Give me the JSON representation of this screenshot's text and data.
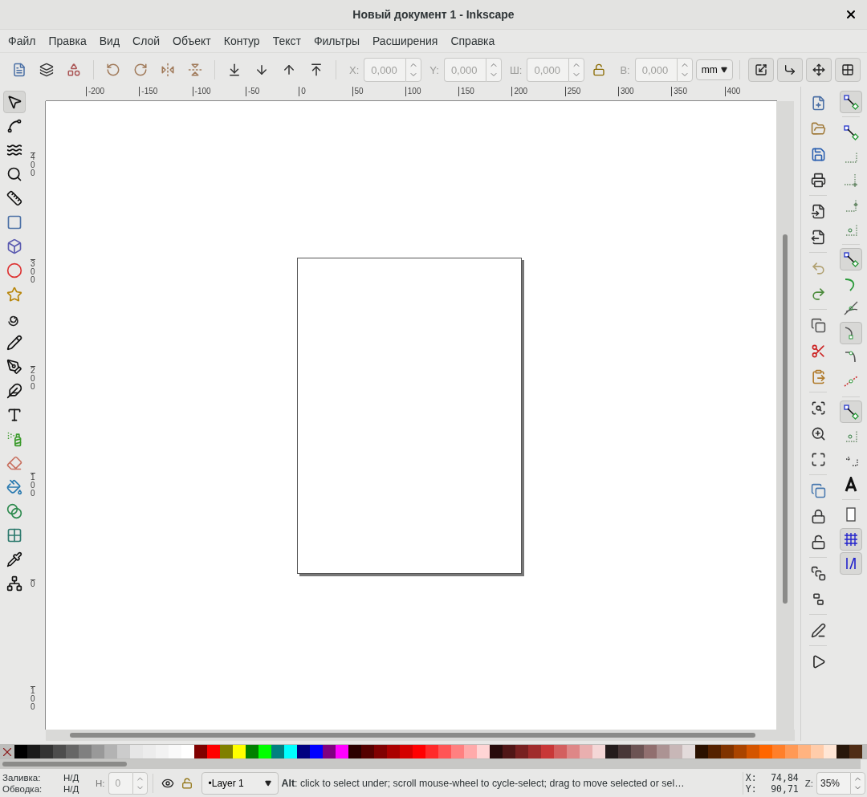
{
  "window": {
    "title": "Новый документ 1 - Inkscape"
  },
  "menu": [
    {
      "label": "Файл"
    },
    {
      "label": "Правка"
    },
    {
      "label": "Вид"
    },
    {
      "label": "Слой"
    },
    {
      "label": "Объект"
    },
    {
      "label": "Контур"
    },
    {
      "label": "Текст"
    },
    {
      "label": "Фильтры"
    },
    {
      "label": "Расширения"
    },
    {
      "label": "Справка"
    }
  ],
  "toolbar_items": [
    {
      "kind": "field",
      "label": "X:",
      "value": "0,000",
      "disabled": true
    },
    {
      "kind": "field",
      "label": "Y:",
      "value": "0,000",
      "disabled": true
    },
    {
      "kind": "field",
      "label": "Ш:",
      "value": "0,000",
      "disabled": true
    },
    {
      "kind": "lock"
    },
    {
      "kind": "field",
      "label": "В:",
      "value": "0,000",
      "disabled": true
    },
    {
      "kind": "unit",
      "value": "mm"
    }
  ],
  "rulers": {
    "horizontal": [
      "-200",
      "-150",
      "-100",
      "-50",
      "0",
      "50",
      "100",
      "150",
      "200",
      "250",
      "300",
      "350",
      "400"
    ],
    "vertical": [
      "400",
      "300",
      "200",
      "100",
      "0",
      "100"
    ]
  },
  "tools": [
    {
      "kind": "selector",
      "selected": true
    },
    {
      "kind": "node",
      "selected": false
    },
    {
      "kind": "tweak",
      "selected": false
    },
    {
      "kind": "zoom",
      "selected": false
    },
    {
      "kind": "measure",
      "selected": false
    },
    {
      "kind": "rect",
      "selected": false
    },
    {
      "kind": "box3d",
      "selected": false
    },
    {
      "kind": "ellipse",
      "selected": false
    },
    {
      "kind": "star",
      "selected": false
    },
    {
      "kind": "spiral",
      "selected": false
    },
    {
      "kind": "pencil",
      "selected": false
    },
    {
      "kind": "pen",
      "selected": false
    },
    {
      "kind": "calligraphy",
      "selected": false
    },
    {
      "kind": "text",
      "selected": false
    },
    {
      "kind": "spray",
      "selected": false
    },
    {
      "kind": "eraser",
      "selected": false
    },
    {
      "kind": "bucket",
      "selected": false
    },
    {
      "kind": "gradient",
      "selected": false
    },
    {
      "kind": "mesh",
      "selected": false
    },
    {
      "kind": "dropper",
      "selected": false
    },
    {
      "kind": "connector",
      "selected": false
    }
  ],
  "snaps": [
    {
      "kind": "node",
      "on": true
    },
    {
      "kind": "node",
      "on": false
    },
    {
      "kind": "edge",
      "on": false
    },
    {
      "kind": "corner",
      "on": false
    },
    {
      "kind": "midpoint",
      "on": false
    },
    {
      "kind": "center",
      "on": false
    },
    {
      "kind": "node",
      "on": true
    },
    {
      "kind": "curve",
      "on": false
    },
    {
      "kind": "intersection",
      "on": false
    },
    {
      "kind": "cusp",
      "on": true
    },
    {
      "kind": "smooth",
      "on": false
    },
    {
      "kind": "linemid",
      "on": false
    },
    {
      "kind": "node",
      "on": true
    },
    {
      "kind": "center",
      "on": false
    },
    {
      "kind": "rotation",
      "on": false
    },
    {
      "kind": "text",
      "on": false
    },
    {
      "kind": "page",
      "on": false
    },
    {
      "kind": "grid",
      "on": true
    },
    {
      "kind": "guide",
      "on": true
    }
  ],
  "palette": [
    {
      "color": "#000000"
    },
    {
      "color": "#1a1a1a"
    },
    {
      "color": "#333333"
    },
    {
      "color": "#4d4d4d"
    },
    {
      "color": "#666666"
    },
    {
      "color": "#808080"
    },
    {
      "color": "#999999"
    },
    {
      "color": "#b3b3b3"
    },
    {
      "color": "#cccccc"
    },
    {
      "color": "#e6e6e6"
    },
    {
      "color": "#ececec"
    },
    {
      "color": "#f2f2f2"
    },
    {
      "color": "#f9f9f9"
    },
    {
      "color": "#ffffff"
    },
    {
      "color": "#800000"
    },
    {
      "color": "#ff0000"
    },
    {
      "color": "#808000"
    },
    {
      "color": "#ffff00"
    },
    {
      "color": "#008000"
    },
    {
      "color": "#00ff00"
    },
    {
      "color": "#008080"
    },
    {
      "color": "#00ffff"
    },
    {
      "color": "#000080"
    },
    {
      "color": "#0000ff"
    },
    {
      "color": "#800080"
    },
    {
      "color": "#ff00ff"
    },
    {
      "color": "#2b0000"
    },
    {
      "color": "#550000"
    },
    {
      "color": "#800001"
    },
    {
      "color": "#aa0000"
    },
    {
      "color": "#d40000"
    },
    {
      "color": "#ff0001"
    },
    {
      "color": "#ff2a2a"
    },
    {
      "color": "#ff5555"
    },
    {
      "color": "#ff8080"
    },
    {
      "color": "#ffaaaa"
    },
    {
      "color": "#ffd5d5"
    },
    {
      "color": "#280b0b"
    },
    {
      "color": "#501616"
    },
    {
      "color": "#782121"
    },
    {
      "color": "#a02c2c"
    },
    {
      "color": "#c83737"
    },
    {
      "color": "#d35f5f"
    },
    {
      "color": "#de8787"
    },
    {
      "color": "#e9afaf"
    },
    {
      "color": "#f4d7d7"
    },
    {
      "color": "#241c1c"
    },
    {
      "color": "#483737"
    },
    {
      "color": "#6c5353"
    },
    {
      "color": "#916f6f"
    },
    {
      "color": "#ac9393"
    },
    {
      "color": "#c8b7b7"
    },
    {
      "color": "#e3dbdb"
    },
    {
      "color": "#2b1100"
    },
    {
      "color": "#552200"
    },
    {
      "color": "#803300"
    },
    {
      "color": "#aa4400"
    },
    {
      "color": "#d45500"
    },
    {
      "color": "#ff6600"
    },
    {
      "color": "#ff7f2a"
    },
    {
      "color": "#ff9955"
    },
    {
      "color": "#ffb380"
    },
    {
      "color": "#ffccaa"
    },
    {
      "color": "#ffe6d5"
    },
    {
      "color": "#28170b"
    },
    {
      "color": "#502d16"
    }
  ],
  "status": {
    "fill_label": "Заливка:",
    "fill_value": "Н/Д",
    "stroke_label": "Обводка:",
    "stroke_value": "Н/Д",
    "opacity_label": "H:",
    "opacity_value": "0",
    "layer": "•Layer 1",
    "message": "**Alt**: click to select under; scroll mouse-wheel to cycle-select; drag to move selected or sel…",
    "x_label": "X:",
    "x_value": "74,84",
    "y_label": "Y:",
    "y_value": "90,71",
    "zoom_label": "Z:",
    "zoom_value": "35%"
  }
}
